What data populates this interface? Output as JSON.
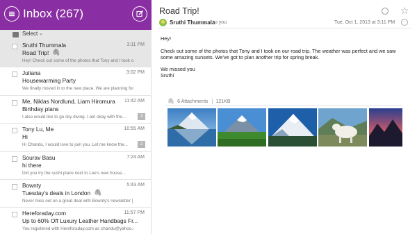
{
  "header": {
    "title": "Inbox (267)",
    "menu_icon": "menu-icon",
    "compose_icon": "compose-icon",
    "color": "#8a2fa3"
  },
  "select_bar": {
    "label": "Select",
    "caret": "⌄"
  },
  "mails": [
    {
      "sender": "Sruthi Thummala",
      "time": "3:11 PM",
      "subject": "Road Trip!",
      "attachment": true,
      "preview": "Hey! Check out some of the photos that Tony and I took on our",
      "badge": "",
      "selected": true
    },
    {
      "sender": "Juliana",
      "time": "3:02 PM",
      "subject": "Housewarming Party",
      "attachment": false,
      "preview": "We finally moved in to the new place. We are planning for...",
      "badge": "",
      "selected": false
    },
    {
      "sender": "Me, Niklas Nordlund, Liam Hiromura",
      "time": "11:42 AM",
      "subject": "Birthday plans",
      "attachment": false,
      "preview": "I also would like to go sky diving. I am okay with the...",
      "badge": "3",
      "selected": false
    },
    {
      "sender": "Tony Lu, Me",
      "time": "10:55 AM",
      "subject": "Hi",
      "attachment": false,
      "preview": "Hi Chandu, I would love to join you. Let me know the...",
      "badge": "2",
      "selected": false
    },
    {
      "sender": "Sourav Basu",
      "time": "7:24 AM",
      "subject": "hi there",
      "attachment": false,
      "preview": "Did you try the sushi place next to Lee's new house...",
      "badge": "",
      "selected": false
    },
    {
      "sender": "Bownty",
      "time": "5:43 AM",
      "subject": "Tuesday's deals in London",
      "attachment": true,
      "preview": "Never miss out on a great deal with Bownty's newsletter |...",
      "badge": "",
      "selected": false
    },
    {
      "sender": "Hereforaday.com",
      "time": "11:57 PM",
      "subject": "Up to 60% Off Luxury Leather Handbags Fr...",
      "attachment": false,
      "preview": "You registered with Hereforaday.com as chandu@yahoo.c...",
      "badge": "",
      "selected": false
    }
  ],
  "message": {
    "subject": "Road Trip!",
    "from": "Sruthi Thummala",
    "to": "to you",
    "date": "Tue, Oct 1, 2013 at 3:11 PM",
    "greeting": "Hey!",
    "paragraph": "Check out some of the photos that Tony and I took on our road trip. The weather was perfect and we saw some amazing sunsets. We've got to plan another trip for spring break.",
    "closing_1": "We missed you",
    "closing_2": "Sruthi",
    "attachments_count": "6 Attachments",
    "attachments_size": "121KB"
  },
  "icons": {
    "attachment": "paperclip-icon",
    "unread": "circle-icon",
    "star": "star-icon",
    "more": "more-icon"
  }
}
